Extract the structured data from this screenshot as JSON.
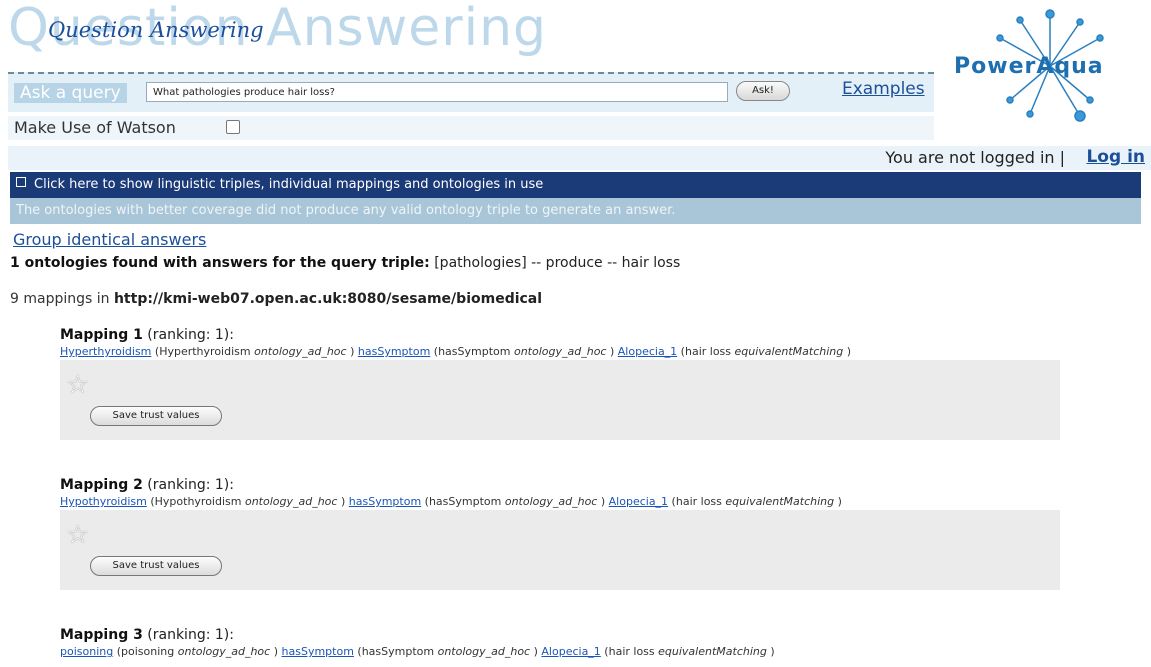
{
  "header": {
    "bg_title": "Question Answering",
    "title": "Question Answering",
    "query_label": "Ask a query",
    "query_value": "What pathologies produce hair loss?",
    "ask_label": "Ask!",
    "examples_label": "Examples",
    "watson_label": "Make Use of Watson",
    "watson_checked": false,
    "login_status": "You are not logged in |",
    "login_label": "Log in",
    "logo_text": "PowerAqua"
  },
  "results": {
    "show_triples": "Click here to show linguistic triples, individual mappings and ontologies in use",
    "coverage_message": "The ontologies with better coverage did not produce any valid ontology triple to generate an answer.",
    "group_link": "Group identical answers",
    "ontologies_bold": "1 ontologies found with answers for the query triple:",
    "ontologies_rest": " [pathologies] -- produce -- hair loss",
    "mappings_count": "9 mappings in ",
    "mappings_source": "http://kmi-web07.open.ac.uk:8080/sesame/biomedical",
    "save_label": "Save trust values",
    "mappings": [
      {
        "title": "Mapping 1",
        "ranking": " (ranking: 1):",
        "subject": "Hyperthyroidism",
        "subject_paren": " (Hyperthyroidism ",
        "subject_ont": "ontology_ad_hoc",
        "relation": "hasSymptom",
        "relation_paren": " (hasSymptom ",
        "relation_ont": "ontology_ad_hoc",
        "object": "Alopecia_1",
        "object_paren": " (hair loss ",
        "object_match": "equivalentMatching"
      },
      {
        "title": "Mapping 2",
        "ranking": " (ranking: 1):",
        "subject": "Hypothyroidism",
        "subject_paren": " (Hypothyroidism ",
        "subject_ont": "ontology_ad_hoc",
        "relation": "hasSymptom",
        "relation_paren": " (hasSymptom ",
        "relation_ont": "ontology_ad_hoc",
        "object": "Alopecia_1",
        "object_paren": " (hair loss ",
        "object_match": "equivalentMatching"
      },
      {
        "title": "Mapping 3",
        "ranking": " (ranking: 1):",
        "subject": "poisoning",
        "subject_paren": " (poisoning ",
        "subject_ont": "ontology_ad_hoc",
        "relation": "hasSymptom",
        "relation_paren": " (hasSymptom ",
        "relation_ont": "ontology_ad_hoc",
        "object": "Alopecia_1",
        "object_paren": " (hair loss ",
        "object_match": "equivalentMatching"
      }
    ]
  }
}
